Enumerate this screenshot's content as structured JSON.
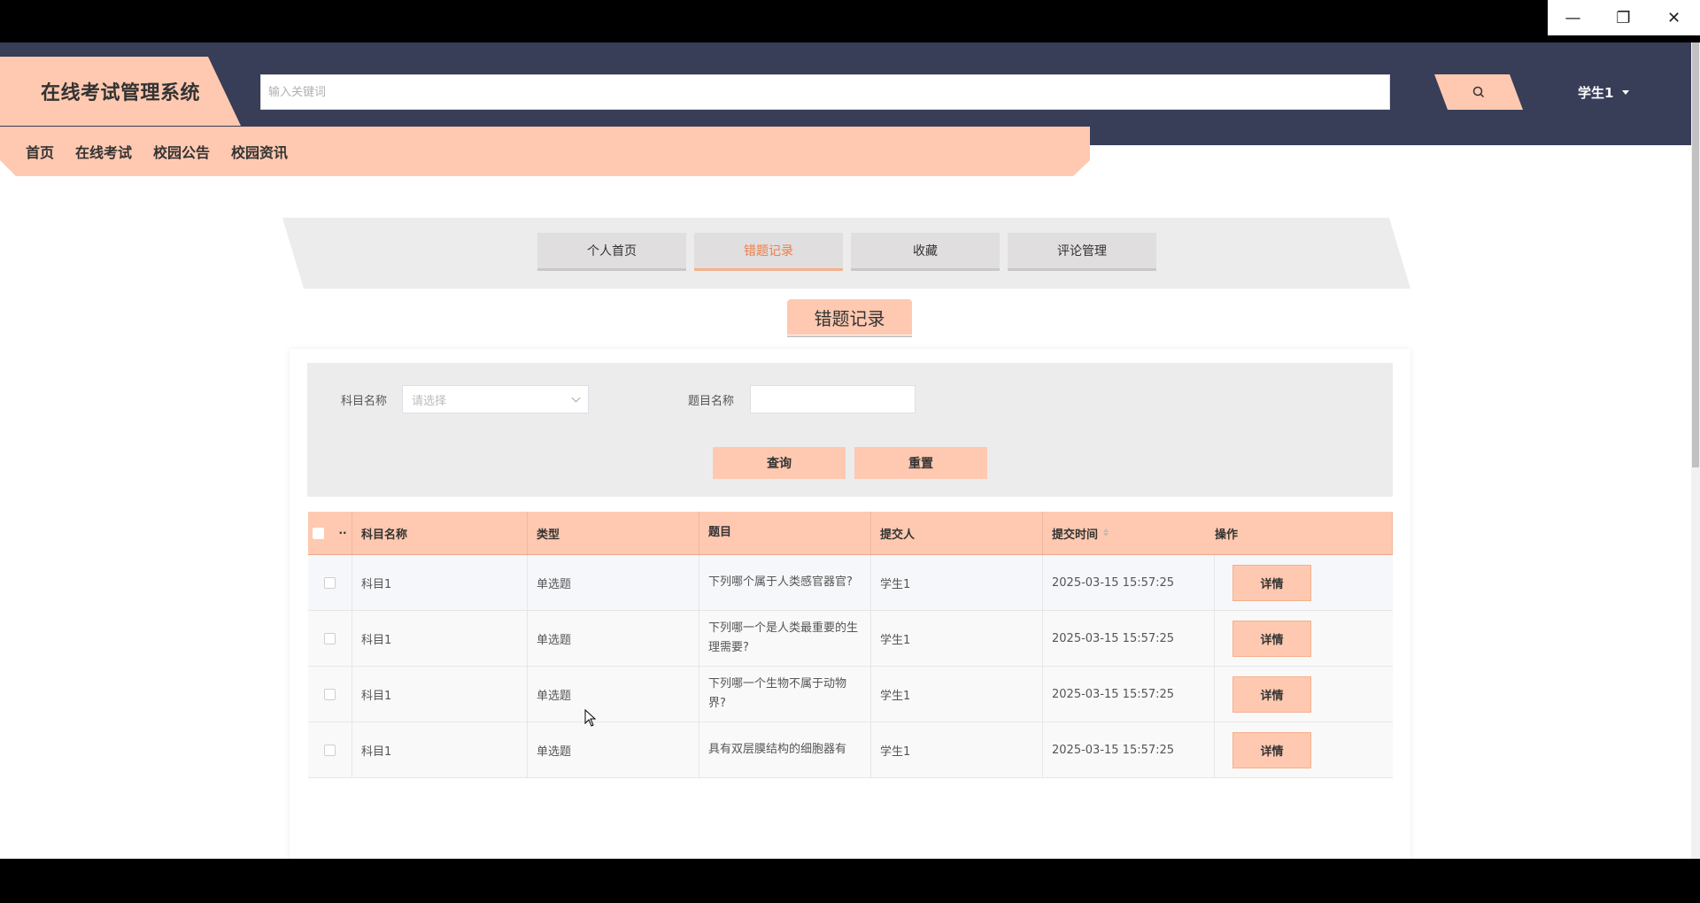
{
  "window": {
    "minimize": "—",
    "restore": "❐",
    "close": "✕"
  },
  "header": {
    "logo": "在线考试管理系统",
    "search_placeholder": "输入关键词",
    "user": "学生1"
  },
  "nav": [
    "首页",
    "在线考试",
    "校园公告",
    "校园资讯"
  ],
  "tabs": [
    "个人首页",
    "错题记录",
    "收藏",
    "评论管理"
  ],
  "active_tab": "错题记录",
  "section_title": "错题记录",
  "filter": {
    "subject_label": "科目名称",
    "subject_placeholder": "请选择",
    "question_label": "题目名称",
    "query_btn": "查询",
    "reset_btn": "重置"
  },
  "table": {
    "columns": [
      "科目名称",
      "类型",
      "题目",
      "提交人",
      "提交时间",
      "操作"
    ],
    "rows": [
      {
        "subject": "科目1",
        "type": "单选题",
        "question": "下列哪个属于人类感官器官?",
        "submitter": "学生1",
        "time": "2025-03-15 15:57:25",
        "action": "详情"
      },
      {
        "subject": "科目1",
        "type": "单选题",
        "question": "下列哪一个是人类最重要的生理需要?",
        "submitter": "学生1",
        "time": "2025-03-15 15:57:25",
        "action": "详情"
      },
      {
        "subject": "科目1",
        "type": "单选题",
        "question": "下列哪一个生物不属于动物界?",
        "submitter": "学生1",
        "time": "2025-03-15 15:57:25",
        "action": "详情"
      },
      {
        "subject": "科目1",
        "type": "单选题",
        "question": "具有双层膜结构的细胞器有",
        "submitter": "学生1",
        "time": "2025-03-15 15:57:25",
        "action": "详情"
      }
    ]
  }
}
